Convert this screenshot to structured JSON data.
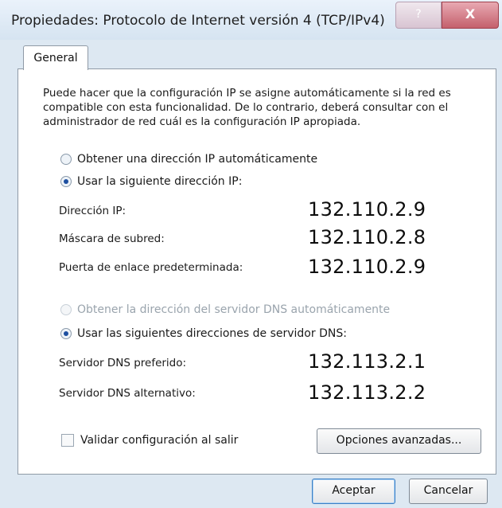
{
  "window": {
    "title": "Propiedades: Protocolo de Internet versión 4 (TCP/IPv4)",
    "help_label": "?",
    "close_label": "X"
  },
  "tabs": [
    {
      "label": "General"
    }
  ],
  "description": "Puede hacer que la configuración IP se asigne automáticamente si la red es compatible con esta funcionalidad. De lo contrario, deberá consultar con el administrador de red cuál es la configuración IP apropiada.",
  "ip_options": {
    "auto_label": "Obtener una dirección IP automáticamente",
    "manual_label": "Usar la siguiente dirección IP:",
    "selected": "manual"
  },
  "ip_fields": [
    {
      "label": "Dirección IP:",
      "value": "132.110.2.9"
    },
    {
      "label": "Máscara de subred:",
      "value": "132.110.2.8"
    },
    {
      "label": "Puerta de enlace predeterminada:",
      "value": "132.110.2.9"
    }
  ],
  "dns_options": {
    "auto_label": "Obtener la dirección del servidor DNS automáticamente",
    "manual_label": "Usar las siguientes direcciones de servidor DNS:",
    "selected": "manual"
  },
  "dns_fields": [
    {
      "label": "Servidor DNS preferido:",
      "value": "132.113.2.1"
    },
    {
      "label": "Servidor DNS alternativo:",
      "value": "132.113.2.2"
    }
  ],
  "validate": {
    "label": "Validar configuración al salir",
    "checked": false
  },
  "buttons": {
    "advanced": "Opciones avanzadas...",
    "ok": "Aceptar",
    "cancel": "Cancelar"
  }
}
